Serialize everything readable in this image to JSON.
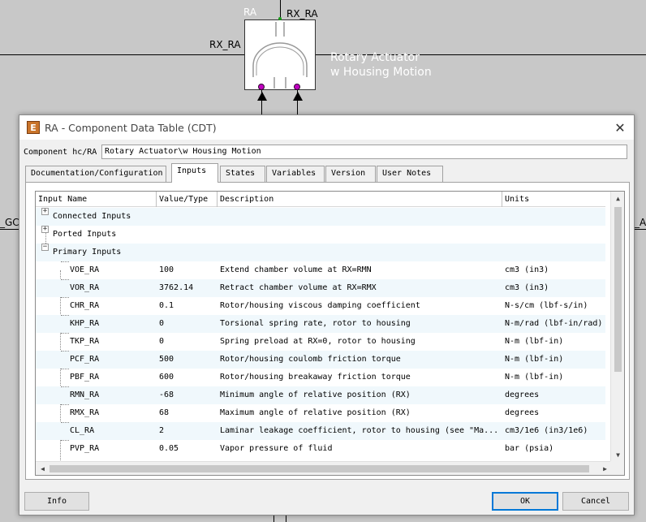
{
  "canvas": {
    "top_label": "RA",
    "top_port_label": "RX_RA",
    "left_port_label": "RX_RA",
    "component_name_line1": "Rotary Actuator",
    "component_name_line2": "w Housing Motion",
    "left_edge_label": "_GCS",
    "right_edge_label": "_AF"
  },
  "dialog": {
    "title": "RA - Component Data Table (CDT)",
    "app_icon_letter": "E",
    "close_glyph": "✕",
    "component_label": "Component hc/RA",
    "component_value": "Rotary Actuator\\w Housing Motion",
    "tabs": [
      {
        "label": "Documentation/Configuration"
      },
      {
        "label": "Inputs"
      },
      {
        "label": "States"
      },
      {
        "label": "Variables"
      },
      {
        "label": "Version"
      },
      {
        "label": "User Notes"
      }
    ],
    "active_tab": "Inputs",
    "columns": {
      "name": "Input Name",
      "value": "Value/Type",
      "desc": "Description",
      "units": "Units"
    },
    "groups": [
      {
        "label": "Connected Inputs",
        "expander": "+"
      },
      {
        "label": "Ported Inputs",
        "expander": "+"
      },
      {
        "label": "Primary Inputs",
        "expander": "−"
      }
    ],
    "rows": [
      {
        "name": "VOE_RA",
        "value": "100",
        "desc": "Extend chamber volume at RX=RMN",
        "units": "cm3 (in3)"
      },
      {
        "name": "VOR_RA",
        "value": "3762.14",
        "desc": "Retract chamber volume at RX=RMX",
        "units": "cm3 (in3)"
      },
      {
        "name": "CHR_RA",
        "value": "0.1",
        "desc": "Rotor/housing viscous damping coefficient",
        "units": "N-s/cm (lbf-s/in)"
      },
      {
        "name": "KHP_RA",
        "value": "0",
        "desc": "Torsional spring rate, rotor to housing",
        "units": "N-m/rad (lbf-in/rad)"
      },
      {
        "name": "TKP_RA",
        "value": "0",
        "desc": "Spring preload at RX=0, rotor to housing",
        "units": "N-m (lbf-in)"
      },
      {
        "name": "PCF_RA",
        "value": "500",
        "desc": "Rotor/housing coulomb friction torque",
        "units": "N-m (lbf-in)"
      },
      {
        "name": "PBF_RA",
        "value": "600",
        "desc": "Rotor/housing breakaway friction torque",
        "units": "N-m (lbf-in)"
      },
      {
        "name": "RMN_RA",
        "value": "-68",
        "desc": "Minimum angle of relative position (RX)",
        "units": "degrees"
      },
      {
        "name": "RMX_RA",
        "value": "68",
        "desc": "Maximum angle of relative position (RX)",
        "units": "degrees"
      },
      {
        "name": "CL_RA",
        "value": "2",
        "desc": "Laminar leakage coefficient, rotor to housing (see \"Ma...",
        "units": "cm3/1e6 (in3/1e6)"
      },
      {
        "name": "PVP_RA",
        "value": "0.05",
        "desc": "Vapor pressure of fluid",
        "units": "bar (psia)"
      }
    ],
    "buttons": {
      "info": "Info",
      "ok": "OK",
      "cancel": "Cancel"
    },
    "colors": {
      "row_alt": "#f0f8fc",
      "port": "#c000c0",
      "default_button_border": "#0078d7"
    }
  }
}
